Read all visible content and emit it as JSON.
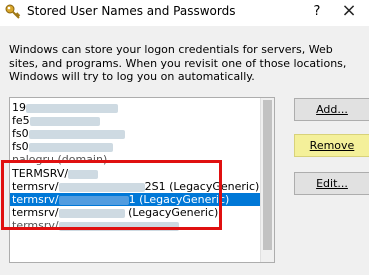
{
  "window": {
    "title": "Stored User Names and Passwords",
    "help_label": "?",
    "close_label": "×"
  },
  "description": "Windows can store your logon credentials for servers, Web sites, and programs. When you revisit one of those locations, Windows will try to log you on automatically.",
  "list": {
    "items": [
      {
        "text": "19",
        "tail": ""
      },
      {
        "text": "fe5",
        "tail": ""
      },
      {
        "text": "fs0",
        "tail": ""
      },
      {
        "text": "fs0",
        "tail": ""
      },
      {
        "text": "nalogru (domain)",
        "tail": ""
      },
      {
        "text": "TERMSRV/",
        "tail": ""
      },
      {
        "text": "termsrv/",
        "tail": "2S1 (LegacyGeneric)"
      },
      {
        "text": "termsrv/",
        "tail": "1 (LegacyGeneric)"
      },
      {
        "text": "termsrv/",
        "tail": " (LegacyGeneric)"
      },
      {
        "text": "termsrv/",
        "tail": ""
      }
    ],
    "selected_index": 7
  },
  "buttons": {
    "add": "Add...",
    "remove": "Remove",
    "edit": "Edit..."
  },
  "colors": {
    "selection": "#0078d7",
    "annotation_box": "#e01010",
    "remove_highlight": "#f4f09a"
  }
}
